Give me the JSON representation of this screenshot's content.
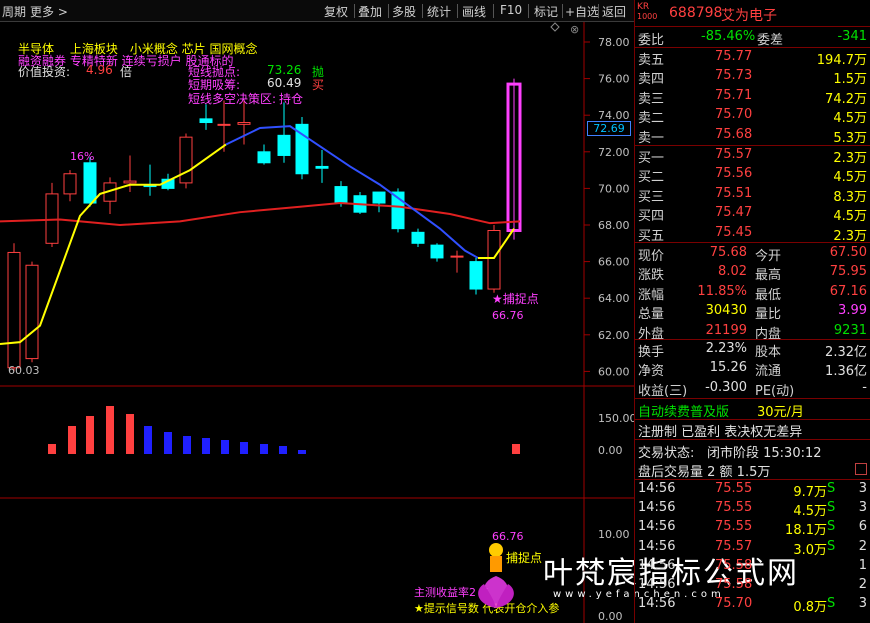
{
  "toolbar": {
    "left_items": [
      "周期",
      "更多 >"
    ],
    "right_items": [
      "复权",
      "叠加",
      "多股",
      "统计",
      "画线",
      "F10",
      "标记",
      "+自选",
      "返回"
    ]
  },
  "chart": {
    "y_axis_labels": [
      "78.00",
      "76.00",
      "74.00",
      "72.00",
      "70.00",
      "68.00",
      "66.00",
      "64.00",
      "62.00",
      "60.00"
    ],
    "current_price_tag": "72.69",
    "low_marker": "60.03",
    "pct_label": "16%",
    "catch_label": "★捕捉点",
    "catch_value": "66.76",
    "indicator_axis": [
      "150.00",
      "0.00"
    ],
    "lower_axis": [
      "10.00",
      "0.00"
    ],
    "overlay_text": {
      "line1": "半导体　 上海板块　小米概念 芯片 国网概念",
      "line2": "融资融券 专精特新 连续亏损户 股通标的",
      "value_label": "价值投资:",
      "value_num": "4.96",
      "value_unit": "倍",
      "short_sell_label": "短线抛点:",
      "short_sell_val": "73.26",
      "short_sell_tag": "抛",
      "short_buy_label": "短期吸筹:",
      "short_buy_val": "60.49",
      "short_buy_tag": "买",
      "decision_label": "短线多空决策区:",
      "decision_val": "持仓"
    },
    "lower_text": {
      "val": "66.76",
      "catch": "捕捉点",
      "income": "主测收益率2 %",
      "hint": "★提示信号数  代表开仓介入参"
    }
  },
  "quote": {
    "code_prefix": "KR",
    "code_sub": "1000",
    "code": "688798",
    "name": "艾为电子",
    "webi_label": "委比",
    "webi_value": "-85.46%",
    "weicha_label": "委差",
    "weicha_value": "-341",
    "sell_levels": [
      {
        "label": "卖五",
        "price": "75.77",
        "vol": "194.7万"
      },
      {
        "label": "卖四",
        "price": "75.73",
        "vol": "1.5万"
      },
      {
        "label": "卖三",
        "price": "75.71",
        "vol": "74.2万"
      },
      {
        "label": "卖二",
        "price": "75.70",
        "vol": "4.5万"
      },
      {
        "label": "卖一",
        "price": "75.68",
        "vol": "5.3万"
      }
    ],
    "buy_levels": [
      {
        "label": "买一",
        "price": "75.57",
        "vol": "2.3万"
      },
      {
        "label": "买二",
        "price": "75.56",
        "vol": "4.5万"
      },
      {
        "label": "买三",
        "price": "75.51",
        "vol": "8.3万"
      },
      {
        "label": "买四",
        "price": "75.47",
        "vol": "4.5万"
      },
      {
        "label": "买五",
        "price": "75.45",
        "vol": "2.3万"
      }
    ],
    "stats": [
      {
        "l1": "现价",
        "v1": "75.68",
        "c1": "red",
        "l2": "今开",
        "v2": "67.50",
        "c2": "red"
      },
      {
        "l1": "涨跌",
        "v1": "8.02",
        "c1": "red",
        "l2": "最高",
        "v2": "75.95",
        "c2": "red"
      },
      {
        "l1": "涨幅",
        "v1": "11.85%",
        "c1": "red",
        "l2": "最低",
        "v2": "67.16",
        "c2": "red"
      },
      {
        "l1": "总量",
        "v1": "30430",
        "c1": "yellow",
        "l2": "量比",
        "v2": "3.99",
        "c2": "mag"
      },
      {
        "l1": "外盘",
        "v1": "21199",
        "c1": "red",
        "l2": "内盘",
        "v2": "9231",
        "c2": "green"
      }
    ],
    "stats2": [
      {
        "l1": "换手",
        "v1": "2.23%",
        "l2": "股本",
        "v2": "2.32亿"
      },
      {
        "l1": "净资",
        "v1": "15.26",
        "l2": "流通",
        "v2": "1.36亿"
      },
      {
        "l1": "收益(三)",
        "v1": "-0.300",
        "l2": "PE(动)",
        "v2": "-"
      }
    ],
    "promo_text": "自动续费普及版",
    "promo_price": "30元/月",
    "promo_line2": "注册制 已盈利 表决权无差异",
    "trade_status_label": "交易状态:",
    "trade_status_value": "闭市阶段 15:30:12",
    "after_hours": "盘后交易量 2 额 1.5万",
    "ticks": [
      {
        "time": "14:56",
        "price": "75.55",
        "vol": "9.7万",
        "side": "S",
        "n": "3"
      },
      {
        "time": "14:56",
        "price": "75.55",
        "vol": "4.5万",
        "side": "S",
        "n": "3"
      },
      {
        "time": "14:56",
        "price": "75.55",
        "vol": "18.1万",
        "side": "S",
        "n": "6"
      },
      {
        "time": "14:56",
        "price": "75.57",
        "vol": "3.0万",
        "side": "S",
        "n": "2"
      },
      {
        "time": "14:56",
        "price": "75.58",
        "vol": "",
        "side": "",
        "n": "1"
      },
      {
        "time": "14:56",
        "price": "75.58",
        "vol": "",
        "side": "",
        "n": "2"
      },
      {
        "time": "14:56",
        "price": "75.70",
        "vol": "0.8万",
        "side": "S",
        "n": "3"
      }
    ]
  },
  "watermark": {
    "main": "叶梵宸指标公式网",
    "sub": "www.yefanchen.com"
  },
  "colors": {
    "up": "#ff4040",
    "down": "#00ffff",
    "ma_yellow": "#ffff00",
    "ma_blue": "#3050ff",
    "ma_red": "#e02020",
    "magenta": "#ff40ff"
  }
}
